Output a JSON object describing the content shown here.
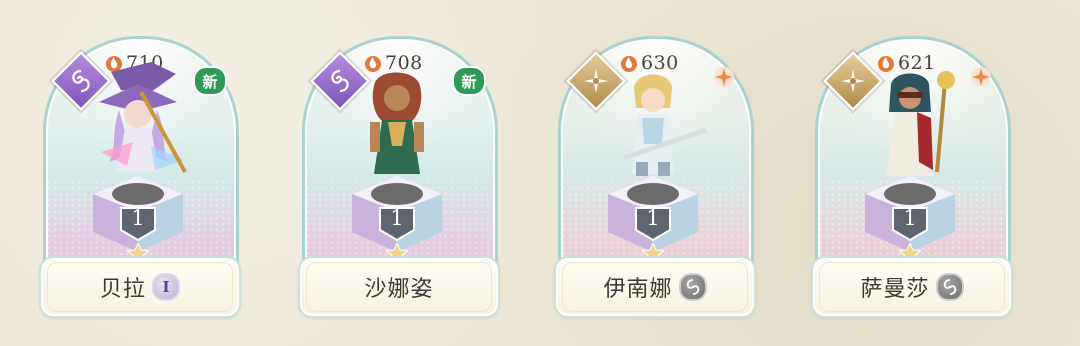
{
  "characters": [
    {
      "name": "贝拉",
      "power": "710",
      "element": "purple-spiral-icon",
      "corner": "new",
      "corner_text": "新",
      "level": "1",
      "name_badge": "roman",
      "name_badge_text": "I"
    },
    {
      "name": "沙娜姿",
      "power": "708",
      "element": "purple-spiral-icon",
      "corner": "new",
      "corner_text": "新",
      "level": "1",
      "name_badge": "none",
      "name_badge_text": ""
    },
    {
      "name": "伊南娜",
      "power": "630",
      "element": "gold-star-icon",
      "corner": "spark",
      "corner_text": "",
      "level": "1",
      "name_badge": "grey",
      "name_badge_text": ""
    },
    {
      "name": "萨曼莎",
      "power": "621",
      "element": "gold-star-icon",
      "corner": "spark",
      "corner_text": "",
      "level": "1",
      "name_badge": "grey",
      "name_badge_text": ""
    }
  ],
  "colors": {
    "purple_element": "#8d63c7",
    "gold_element": "#c9a468",
    "new_badge": "#2f9a57",
    "spark": "#f08a4a",
    "frame_border": "#a8d2cf"
  }
}
